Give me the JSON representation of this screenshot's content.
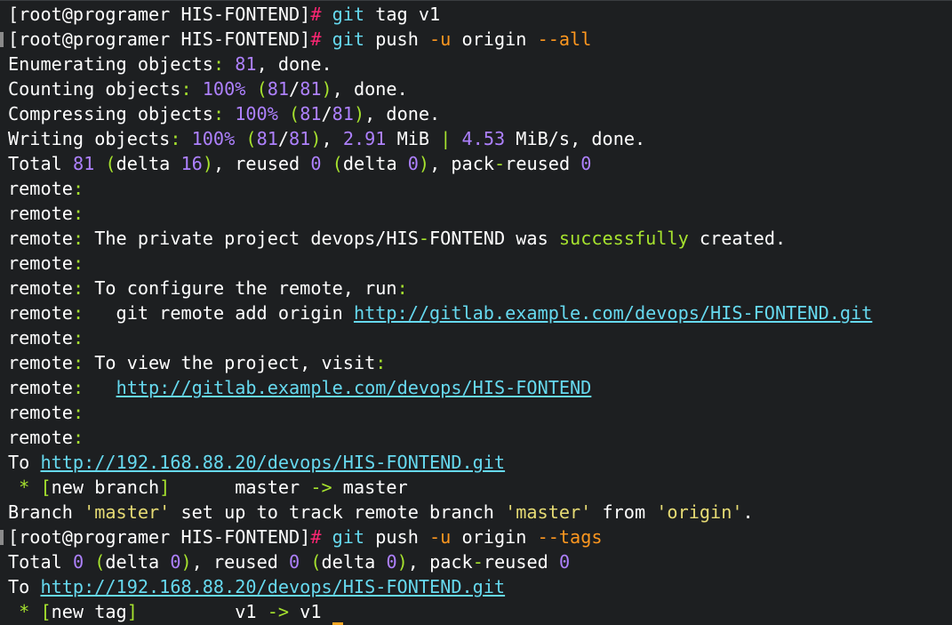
{
  "window": {
    "title": "terminal"
  },
  "colors": {
    "background": "#1d1f21",
    "text": "#ffffff",
    "command": "#66d9ef",
    "prompt_symbol": "#f92672",
    "flag": "#fd971f",
    "number": "#ae81ff",
    "punctuation": "#a6e22e",
    "success": "#a6e22e",
    "link": "#66d9ef",
    "string": "#e6db74",
    "cursor": "#f5a623"
  },
  "lines": [
    {
      "marker": false,
      "segments": [
        {
          "t": "[root@programer HIS-FONTEND]",
          "c": "plain"
        },
        {
          "t": "# ",
          "c": "prompt"
        },
        {
          "t": "git",
          "c": "cmd"
        },
        {
          "t": " tag v1",
          "c": "plain"
        }
      ]
    },
    {
      "marker": true,
      "segments": [
        {
          "t": "[root@programer HIS-FONTEND]",
          "c": "plain"
        },
        {
          "t": "# ",
          "c": "prompt"
        },
        {
          "t": "git",
          "c": "cmd"
        },
        {
          "t": " push ",
          "c": "plain"
        },
        {
          "t": "-u",
          "c": "flag"
        },
        {
          "t": " origin ",
          "c": "plain"
        },
        {
          "t": "--all",
          "c": "flag"
        }
      ]
    },
    {
      "marker": false,
      "segments": [
        {
          "t": "Enumerating objects",
          "c": "plain"
        },
        {
          "t": ":",
          "c": "punct"
        },
        {
          "t": " ",
          "c": "plain"
        },
        {
          "t": "81",
          "c": "num"
        },
        {
          "t": ", done.",
          "c": "plain"
        }
      ]
    },
    {
      "marker": false,
      "segments": [
        {
          "t": "Counting objects",
          "c": "plain"
        },
        {
          "t": ":",
          "c": "punct"
        },
        {
          "t": " ",
          "c": "plain"
        },
        {
          "t": "100%",
          "c": "num"
        },
        {
          "t": " ",
          "c": "plain"
        },
        {
          "t": "(",
          "c": "punct"
        },
        {
          "t": "81",
          "c": "num"
        },
        {
          "t": "/",
          "c": "plain"
        },
        {
          "t": "81",
          "c": "num"
        },
        {
          "t": ")",
          "c": "punct"
        },
        {
          "t": ", done.",
          "c": "plain"
        }
      ]
    },
    {
      "marker": false,
      "segments": [
        {
          "t": "Compressing objects",
          "c": "plain"
        },
        {
          "t": ":",
          "c": "punct"
        },
        {
          "t": " ",
          "c": "plain"
        },
        {
          "t": "100%",
          "c": "num"
        },
        {
          "t": " ",
          "c": "plain"
        },
        {
          "t": "(",
          "c": "punct"
        },
        {
          "t": "81",
          "c": "num"
        },
        {
          "t": "/",
          "c": "plain"
        },
        {
          "t": "81",
          "c": "num"
        },
        {
          "t": ")",
          "c": "punct"
        },
        {
          "t": ", done.",
          "c": "plain"
        }
      ]
    },
    {
      "marker": false,
      "segments": [
        {
          "t": "Writing objects",
          "c": "plain"
        },
        {
          "t": ":",
          "c": "punct"
        },
        {
          "t": " ",
          "c": "plain"
        },
        {
          "t": "100%",
          "c": "num"
        },
        {
          "t": " ",
          "c": "plain"
        },
        {
          "t": "(",
          "c": "punct"
        },
        {
          "t": "81",
          "c": "num"
        },
        {
          "t": "/",
          "c": "plain"
        },
        {
          "t": "81",
          "c": "num"
        },
        {
          "t": ")",
          "c": "punct"
        },
        {
          "t": ", ",
          "c": "plain"
        },
        {
          "t": "2.91",
          "c": "num"
        },
        {
          "t": " MiB ",
          "c": "plain"
        },
        {
          "t": "|",
          "c": "punct"
        },
        {
          "t": " ",
          "c": "plain"
        },
        {
          "t": "4.53",
          "c": "num"
        },
        {
          "t": " MiB/s, done.",
          "c": "plain"
        }
      ]
    },
    {
      "marker": false,
      "segments": [
        {
          "t": "Total ",
          "c": "plain"
        },
        {
          "t": "81",
          "c": "num"
        },
        {
          "t": " ",
          "c": "plain"
        },
        {
          "t": "(",
          "c": "punct"
        },
        {
          "t": "delta ",
          "c": "plain"
        },
        {
          "t": "16",
          "c": "num"
        },
        {
          "t": ")",
          "c": "punct"
        },
        {
          "t": ", reused ",
          "c": "plain"
        },
        {
          "t": "0",
          "c": "num"
        },
        {
          "t": " ",
          "c": "plain"
        },
        {
          "t": "(",
          "c": "punct"
        },
        {
          "t": "delta ",
          "c": "plain"
        },
        {
          "t": "0",
          "c": "num"
        },
        {
          "t": ")",
          "c": "punct"
        },
        {
          "t": ", pack",
          "c": "plain"
        },
        {
          "t": "-",
          "c": "punct"
        },
        {
          "t": "reused ",
          "c": "plain"
        },
        {
          "t": "0",
          "c": "num"
        }
      ]
    },
    {
      "marker": false,
      "segments": [
        {
          "t": "remote",
          "c": "plain"
        },
        {
          "t": ":",
          "c": "punct"
        }
      ]
    },
    {
      "marker": false,
      "segments": [
        {
          "t": "remote",
          "c": "plain"
        },
        {
          "t": ":",
          "c": "punct"
        }
      ]
    },
    {
      "marker": false,
      "segments": [
        {
          "t": "remote",
          "c": "plain"
        },
        {
          "t": ":",
          "c": "punct"
        },
        {
          "t": " The private project devops/HIS",
          "c": "plain"
        },
        {
          "t": "-",
          "c": "punct"
        },
        {
          "t": "FONTEND was ",
          "c": "plain"
        },
        {
          "t": "successfully",
          "c": "ok"
        },
        {
          "t": " created.",
          "c": "plain"
        }
      ]
    },
    {
      "marker": false,
      "segments": [
        {
          "t": "remote",
          "c": "plain"
        },
        {
          "t": ":",
          "c": "punct"
        }
      ]
    },
    {
      "marker": false,
      "segments": [
        {
          "t": "remote",
          "c": "plain"
        },
        {
          "t": ":",
          "c": "punct"
        },
        {
          "t": " To configure the remote, run",
          "c": "plain"
        },
        {
          "t": ":",
          "c": "punct"
        }
      ]
    },
    {
      "marker": false,
      "segments": [
        {
          "t": "remote",
          "c": "plain"
        },
        {
          "t": ":",
          "c": "punct"
        },
        {
          "t": "   git remote add origin ",
          "c": "plain"
        },
        {
          "t": "http://gitlab.example.com/devops/HIS-FONTEND.git",
          "c": "link"
        }
      ]
    },
    {
      "marker": false,
      "segments": [
        {
          "t": "remote",
          "c": "plain"
        },
        {
          "t": ":",
          "c": "punct"
        }
      ]
    },
    {
      "marker": false,
      "segments": [
        {
          "t": "remote",
          "c": "plain"
        },
        {
          "t": ":",
          "c": "punct"
        },
        {
          "t": " To view the project, visit",
          "c": "plain"
        },
        {
          "t": ":",
          "c": "punct"
        }
      ]
    },
    {
      "marker": false,
      "segments": [
        {
          "t": "remote",
          "c": "plain"
        },
        {
          "t": ":",
          "c": "punct"
        },
        {
          "t": "   ",
          "c": "plain"
        },
        {
          "t": "http://gitlab.example.com/devops/HIS-FONTEND",
          "c": "link"
        }
      ]
    },
    {
      "marker": false,
      "segments": [
        {
          "t": "remote",
          "c": "plain"
        },
        {
          "t": ":",
          "c": "punct"
        }
      ]
    },
    {
      "marker": false,
      "segments": [
        {
          "t": "remote",
          "c": "plain"
        },
        {
          "t": ":",
          "c": "punct"
        }
      ]
    },
    {
      "marker": false,
      "segments": [
        {
          "t": "To ",
          "c": "plain"
        },
        {
          "t": "http://192.168.88.20/devops/HIS-FONTEND.git",
          "c": "link"
        }
      ]
    },
    {
      "marker": false,
      "segments": [
        {
          "t": " ",
          "c": "plain"
        },
        {
          "t": "*",
          "c": "punct"
        },
        {
          "t": " ",
          "c": "plain"
        },
        {
          "t": "[",
          "c": "punct"
        },
        {
          "t": "new branch",
          "c": "plain"
        },
        {
          "t": "]",
          "c": "punct"
        },
        {
          "t": "      master ",
          "c": "plain"
        },
        {
          "t": "->",
          "c": "punct"
        },
        {
          "t": " master",
          "c": "plain"
        }
      ]
    },
    {
      "marker": false,
      "segments": [
        {
          "t": "Branch ",
          "c": "plain"
        },
        {
          "t": "'master'",
          "c": "str"
        },
        {
          "t": " set up to track remote branch ",
          "c": "plain"
        },
        {
          "t": "'master'",
          "c": "str"
        },
        {
          "t": " from ",
          "c": "plain"
        },
        {
          "t": "'origin'",
          "c": "str"
        },
        {
          "t": ".",
          "c": "plain"
        }
      ]
    },
    {
      "marker": true,
      "segments": [
        {
          "t": "[root@programer HIS-FONTEND]",
          "c": "plain"
        },
        {
          "t": "# ",
          "c": "prompt"
        },
        {
          "t": "git",
          "c": "cmd"
        },
        {
          "t": " push ",
          "c": "plain"
        },
        {
          "t": "-u",
          "c": "flag"
        },
        {
          "t": " origin ",
          "c": "plain"
        },
        {
          "t": "--tags",
          "c": "flag"
        }
      ]
    },
    {
      "marker": false,
      "segments": [
        {
          "t": "Total ",
          "c": "plain"
        },
        {
          "t": "0",
          "c": "num"
        },
        {
          "t": " ",
          "c": "plain"
        },
        {
          "t": "(",
          "c": "punct"
        },
        {
          "t": "delta ",
          "c": "plain"
        },
        {
          "t": "0",
          "c": "num"
        },
        {
          "t": ")",
          "c": "punct"
        },
        {
          "t": ", reused ",
          "c": "plain"
        },
        {
          "t": "0",
          "c": "num"
        },
        {
          "t": " ",
          "c": "plain"
        },
        {
          "t": "(",
          "c": "punct"
        },
        {
          "t": "delta ",
          "c": "plain"
        },
        {
          "t": "0",
          "c": "num"
        },
        {
          "t": ")",
          "c": "punct"
        },
        {
          "t": ", pack",
          "c": "plain"
        },
        {
          "t": "-",
          "c": "punct"
        },
        {
          "t": "reused ",
          "c": "plain"
        },
        {
          "t": "0",
          "c": "num"
        }
      ]
    },
    {
      "marker": false,
      "segments": [
        {
          "t": "To ",
          "c": "plain"
        },
        {
          "t": "http://192.168.88.20/devops/HIS-FONTEND.git",
          "c": "link"
        }
      ]
    },
    {
      "marker": false,
      "cursor": true,
      "segments": [
        {
          "t": " ",
          "c": "plain"
        },
        {
          "t": "*",
          "c": "punct"
        },
        {
          "t": " ",
          "c": "plain"
        },
        {
          "t": "[",
          "c": "punct"
        },
        {
          "t": "new tag",
          "c": "plain"
        },
        {
          "t": "]",
          "c": "punct"
        },
        {
          "t": "         v1 ",
          "c": "plain"
        },
        {
          "t": "->",
          "c": "punct"
        },
        {
          "t": " v1 ",
          "c": "plain"
        }
      ]
    }
  ]
}
